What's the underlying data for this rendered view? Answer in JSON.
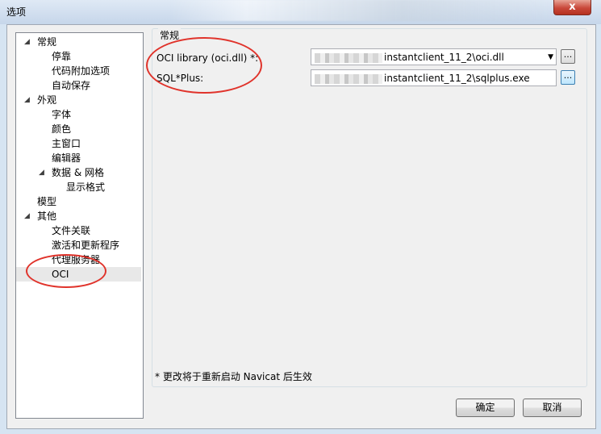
{
  "window": {
    "title": "选项",
    "close_glyph": "x"
  },
  "tree": [
    {
      "label": "常规",
      "level": 0,
      "expanded": true
    },
    {
      "label": "停靠",
      "level": 1
    },
    {
      "label": "代码附加选项",
      "level": 1
    },
    {
      "label": "自动保存",
      "level": 1
    },
    {
      "label": "外观",
      "level": 0,
      "expanded": true
    },
    {
      "label": "字体",
      "level": 1
    },
    {
      "label": "颜色",
      "level": 1
    },
    {
      "label": "主窗口",
      "level": 1
    },
    {
      "label": "编辑器",
      "level": 1
    },
    {
      "label": "数据 & 网格",
      "level": 1,
      "expanded": true
    },
    {
      "label": "显示格式",
      "level": 2
    },
    {
      "label": "模型",
      "level": 0
    },
    {
      "label": "其他",
      "level": 0,
      "expanded": true
    },
    {
      "label": "文件关联",
      "level": 1
    },
    {
      "label": "激活和更新程序",
      "level": 1
    },
    {
      "label": "代理服务器",
      "level": 1
    },
    {
      "label": "OCI",
      "level": 1,
      "selected": true
    }
  ],
  "group": {
    "title": "常规"
  },
  "fields": {
    "oci_label": "OCI library (oci.dll) *:",
    "oci_value": "instantclient_11_2\\oci.dll",
    "sqlplus_label": "SQL*Plus:",
    "sqlplus_value": "instantclient_11_2\\sqlplus.exe",
    "browse": "..."
  },
  "note": "* 更改将于重新启动 Navicat 后生效",
  "buttons": {
    "ok": "确定",
    "cancel": "取消"
  },
  "colors": {
    "annotation": "#e0332b"
  }
}
